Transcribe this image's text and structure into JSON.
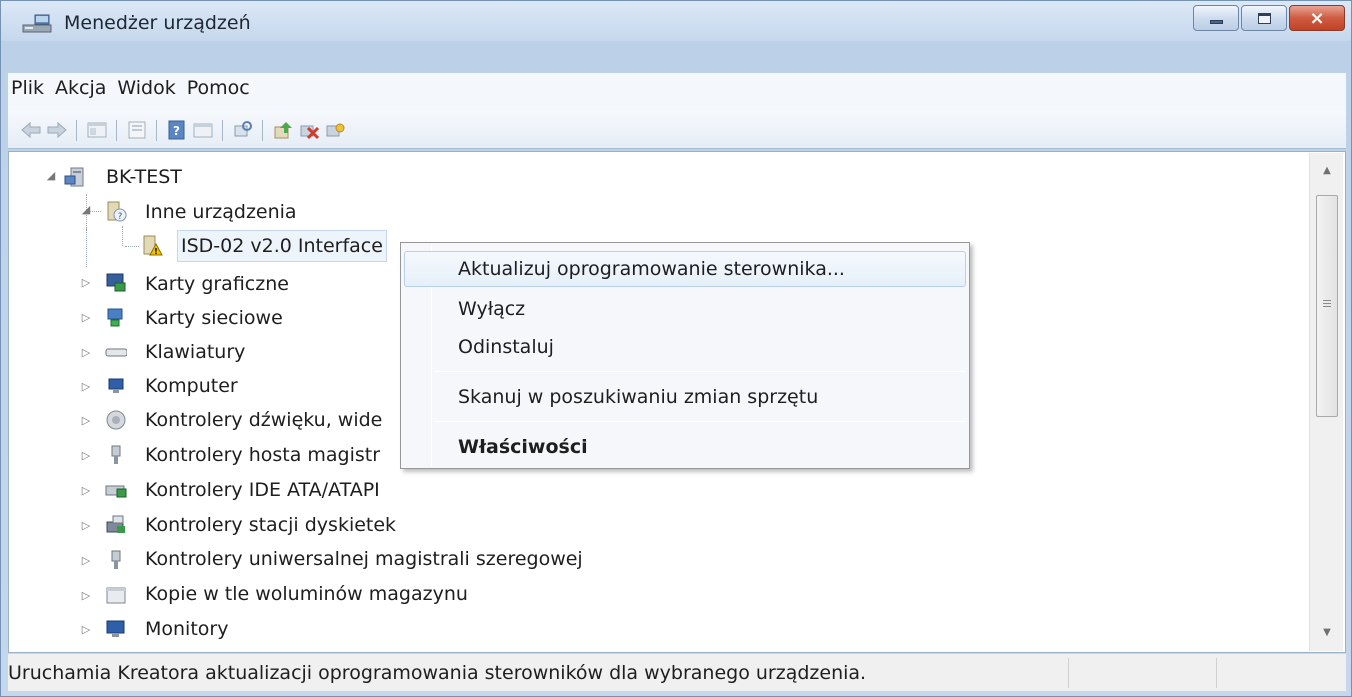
{
  "window": {
    "title": "Menedżer urządzeń",
    "minimize_icon": "minimize-icon",
    "maximize_icon": "maximize-icon",
    "close_glyph": "×"
  },
  "menubar": {
    "items": [
      "Plik",
      "Akcja",
      "Widok",
      "Pomoc"
    ]
  },
  "toolbar": {
    "icons": [
      "back-arrow-icon",
      "forward-arrow-icon",
      "show-hide-console-tree-icon",
      "properties-icon",
      "help-icon",
      "console-view-icon",
      "scan-hardware-icon",
      "update-driver-icon",
      "uninstall-icon",
      "enable-device-icon"
    ]
  },
  "tree": {
    "root": "BK-TEST",
    "other_devices": "Inne urządzenia",
    "selected_device": "ISD-02 v2.0 Interface",
    "categories": [
      "Karty graficzne",
      "Karty sieciowe",
      "Klawiatury",
      "Komputer",
      "Kontrolery dźwięku, wide",
      "Kontrolery hosta magistr",
      "Kontrolery IDE ATA/ATAPI",
      "Kontrolery stacji dyskietek",
      "Kontrolery uniwersalnej magistrali szeregowej",
      "Kopie w tle woluminów magazynu",
      "Monitory"
    ]
  },
  "context_menu": {
    "update_driver": "Aktualizuj oprogramowanie sterownika...",
    "disable": "Wyłącz",
    "uninstall": "Odinstaluj",
    "scan": "Skanuj w poszukiwaniu zmian sprzętu",
    "properties": "Właściwości"
  },
  "statusbar": {
    "text": "Uruchamia Kreatora aktualizacji oprogramowania sterowników dla wybranego urządzenia."
  },
  "colors": {
    "accent": "#3a6ea5",
    "close_button": "#c14326",
    "warning": "#f2c200"
  }
}
